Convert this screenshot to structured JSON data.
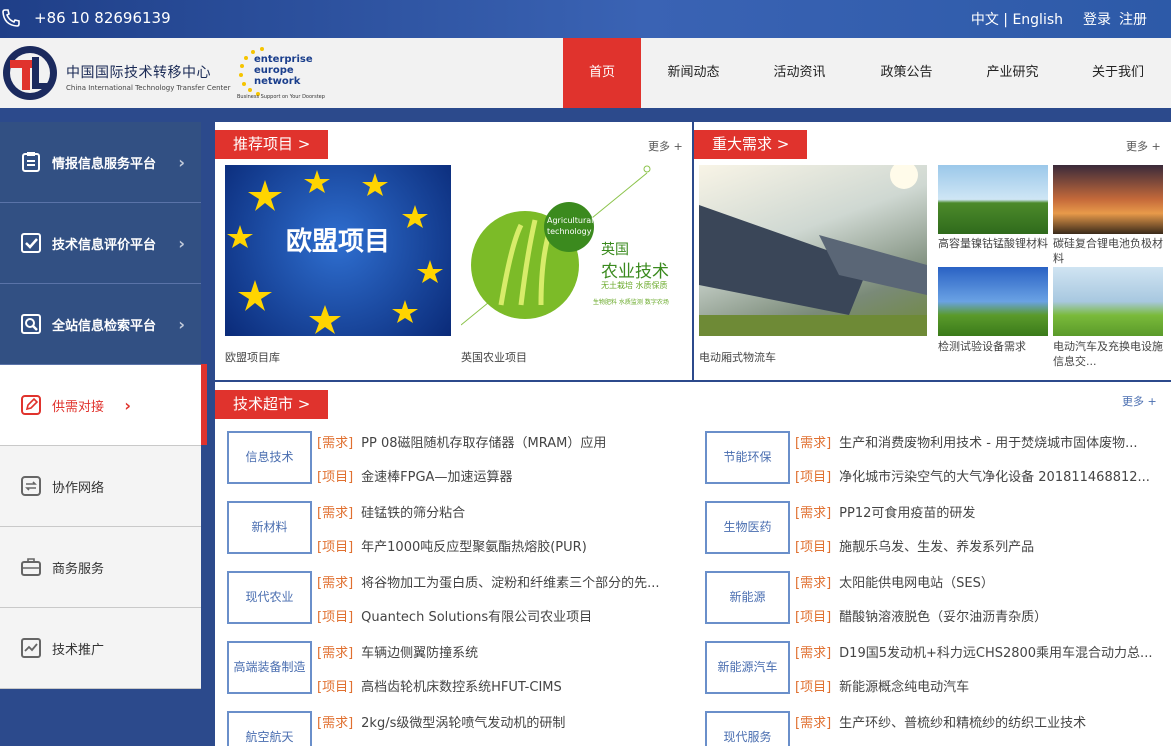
{
  "top": {
    "phone": "+86 10 82696139",
    "lang": "中文 | English",
    "login": "登录",
    "register": "注册"
  },
  "logo": {
    "cn": "中国国际技术转移中心",
    "en": "China International Technology Transfer Center",
    "een_line1": "enterprise",
    "een_line2": "europe",
    "een_line3": "network",
    "een_sub": "Business Support on Your Doorstep"
  },
  "nav": [
    "首页",
    "新闻动态",
    "活动资讯",
    "政策公告",
    "产业研究",
    "关于我们"
  ],
  "sidebar": [
    "情报信息服务平台",
    "技术信息评价平台",
    "全站信息检索平台",
    "供需对接",
    "协作网络",
    "商务服务",
    "技术推广"
  ],
  "recommend": {
    "title": "推荐项目  >",
    "more": "更多 +",
    "img1_text": "欧盟项目",
    "img2_title1": "英国",
    "img2_title2": "农业技术",
    "img2_tag": "Agricultural technology",
    "img2_sub": "无土栽培 水质保质",
    "img2_small": "生物肥料 水质监测 数字农场",
    "items": [
      "欧盟项目库",
      "英国农业项目"
    ]
  },
  "demand": {
    "title": "重大需求  >",
    "more": "更多 +",
    "items": [
      "电动厢式物流车",
      "高容量镍钴锰酸锂材料",
      "碳硅复合锂电池负极材料",
      "检测试验设备需求",
      "电动汽车及充换电设施信息交..."
    ]
  },
  "market": {
    "title": "技术超市  >",
    "more": "更多 +",
    "left": [
      {
        "cat": "信息技术",
        "rows": [
          [
            "[需求]",
            "PP 08磁阻随机存取存储器（MRAM）应用"
          ],
          [
            "[项目]",
            "金速棒FPGA—加速运算器"
          ]
        ]
      },
      {
        "cat": "新材料",
        "rows": [
          [
            "[需求]",
            "硅锰铁的筛分粘合"
          ],
          [
            "[项目]",
            "年产1000吨反应型聚氨酯热熔胶(PUR)"
          ]
        ]
      },
      {
        "cat": "现代农业",
        "rows": [
          [
            "[需求]",
            "将谷物加工为蛋白质、淀粉和纤维素三个部分的先..."
          ],
          [
            "[项目]",
            "Quantech Solutions有限公司农业项目"
          ]
        ]
      },
      {
        "cat": "高端装备制造",
        "rows": [
          [
            "[需求]",
            "车辆边侧翼防撞系统"
          ],
          [
            "[项目]",
            "高档齿轮机床数控系统HFUT-CIMS"
          ]
        ]
      },
      {
        "cat": "航空航天",
        "rows": [
          [
            "[需求]",
            "2kg/s级微型涡轮喷气发动机的研制"
          ]
        ]
      }
    ],
    "right": [
      {
        "cat": "节能环保",
        "rows": [
          [
            "[需求]",
            "生产和消费废物利用技术 - 用于焚烧城市固体废物..."
          ],
          [
            "[项目]",
            "净化城市污染空气的大气净化设备 201811468812..."
          ]
        ]
      },
      {
        "cat": "生物医药",
        "rows": [
          [
            "[需求]",
            "PP12可食用疫苗的研发"
          ],
          [
            "[项目]",
            "施靓乐乌发、生发、养发系列产品"
          ]
        ]
      },
      {
        "cat": "新能源",
        "rows": [
          [
            "[需求]",
            "太阳能供电网电站（SES）"
          ],
          [
            "[项目]",
            "醋酸钠溶液脱色（妥尔油沥青杂质）"
          ]
        ]
      },
      {
        "cat": "新能源汽车",
        "rows": [
          [
            "[需求]",
            "D19国5发动机+科力远CHS2800乘用车混合动力总..."
          ],
          [
            "[项目]",
            "新能源概念纯电动汽车"
          ]
        ]
      },
      {
        "cat": "现代服务",
        "rows": [
          [
            "[需求]",
            "生产环纱、普梳纱和精梳纱的纺织工业技术"
          ]
        ]
      }
    ]
  }
}
